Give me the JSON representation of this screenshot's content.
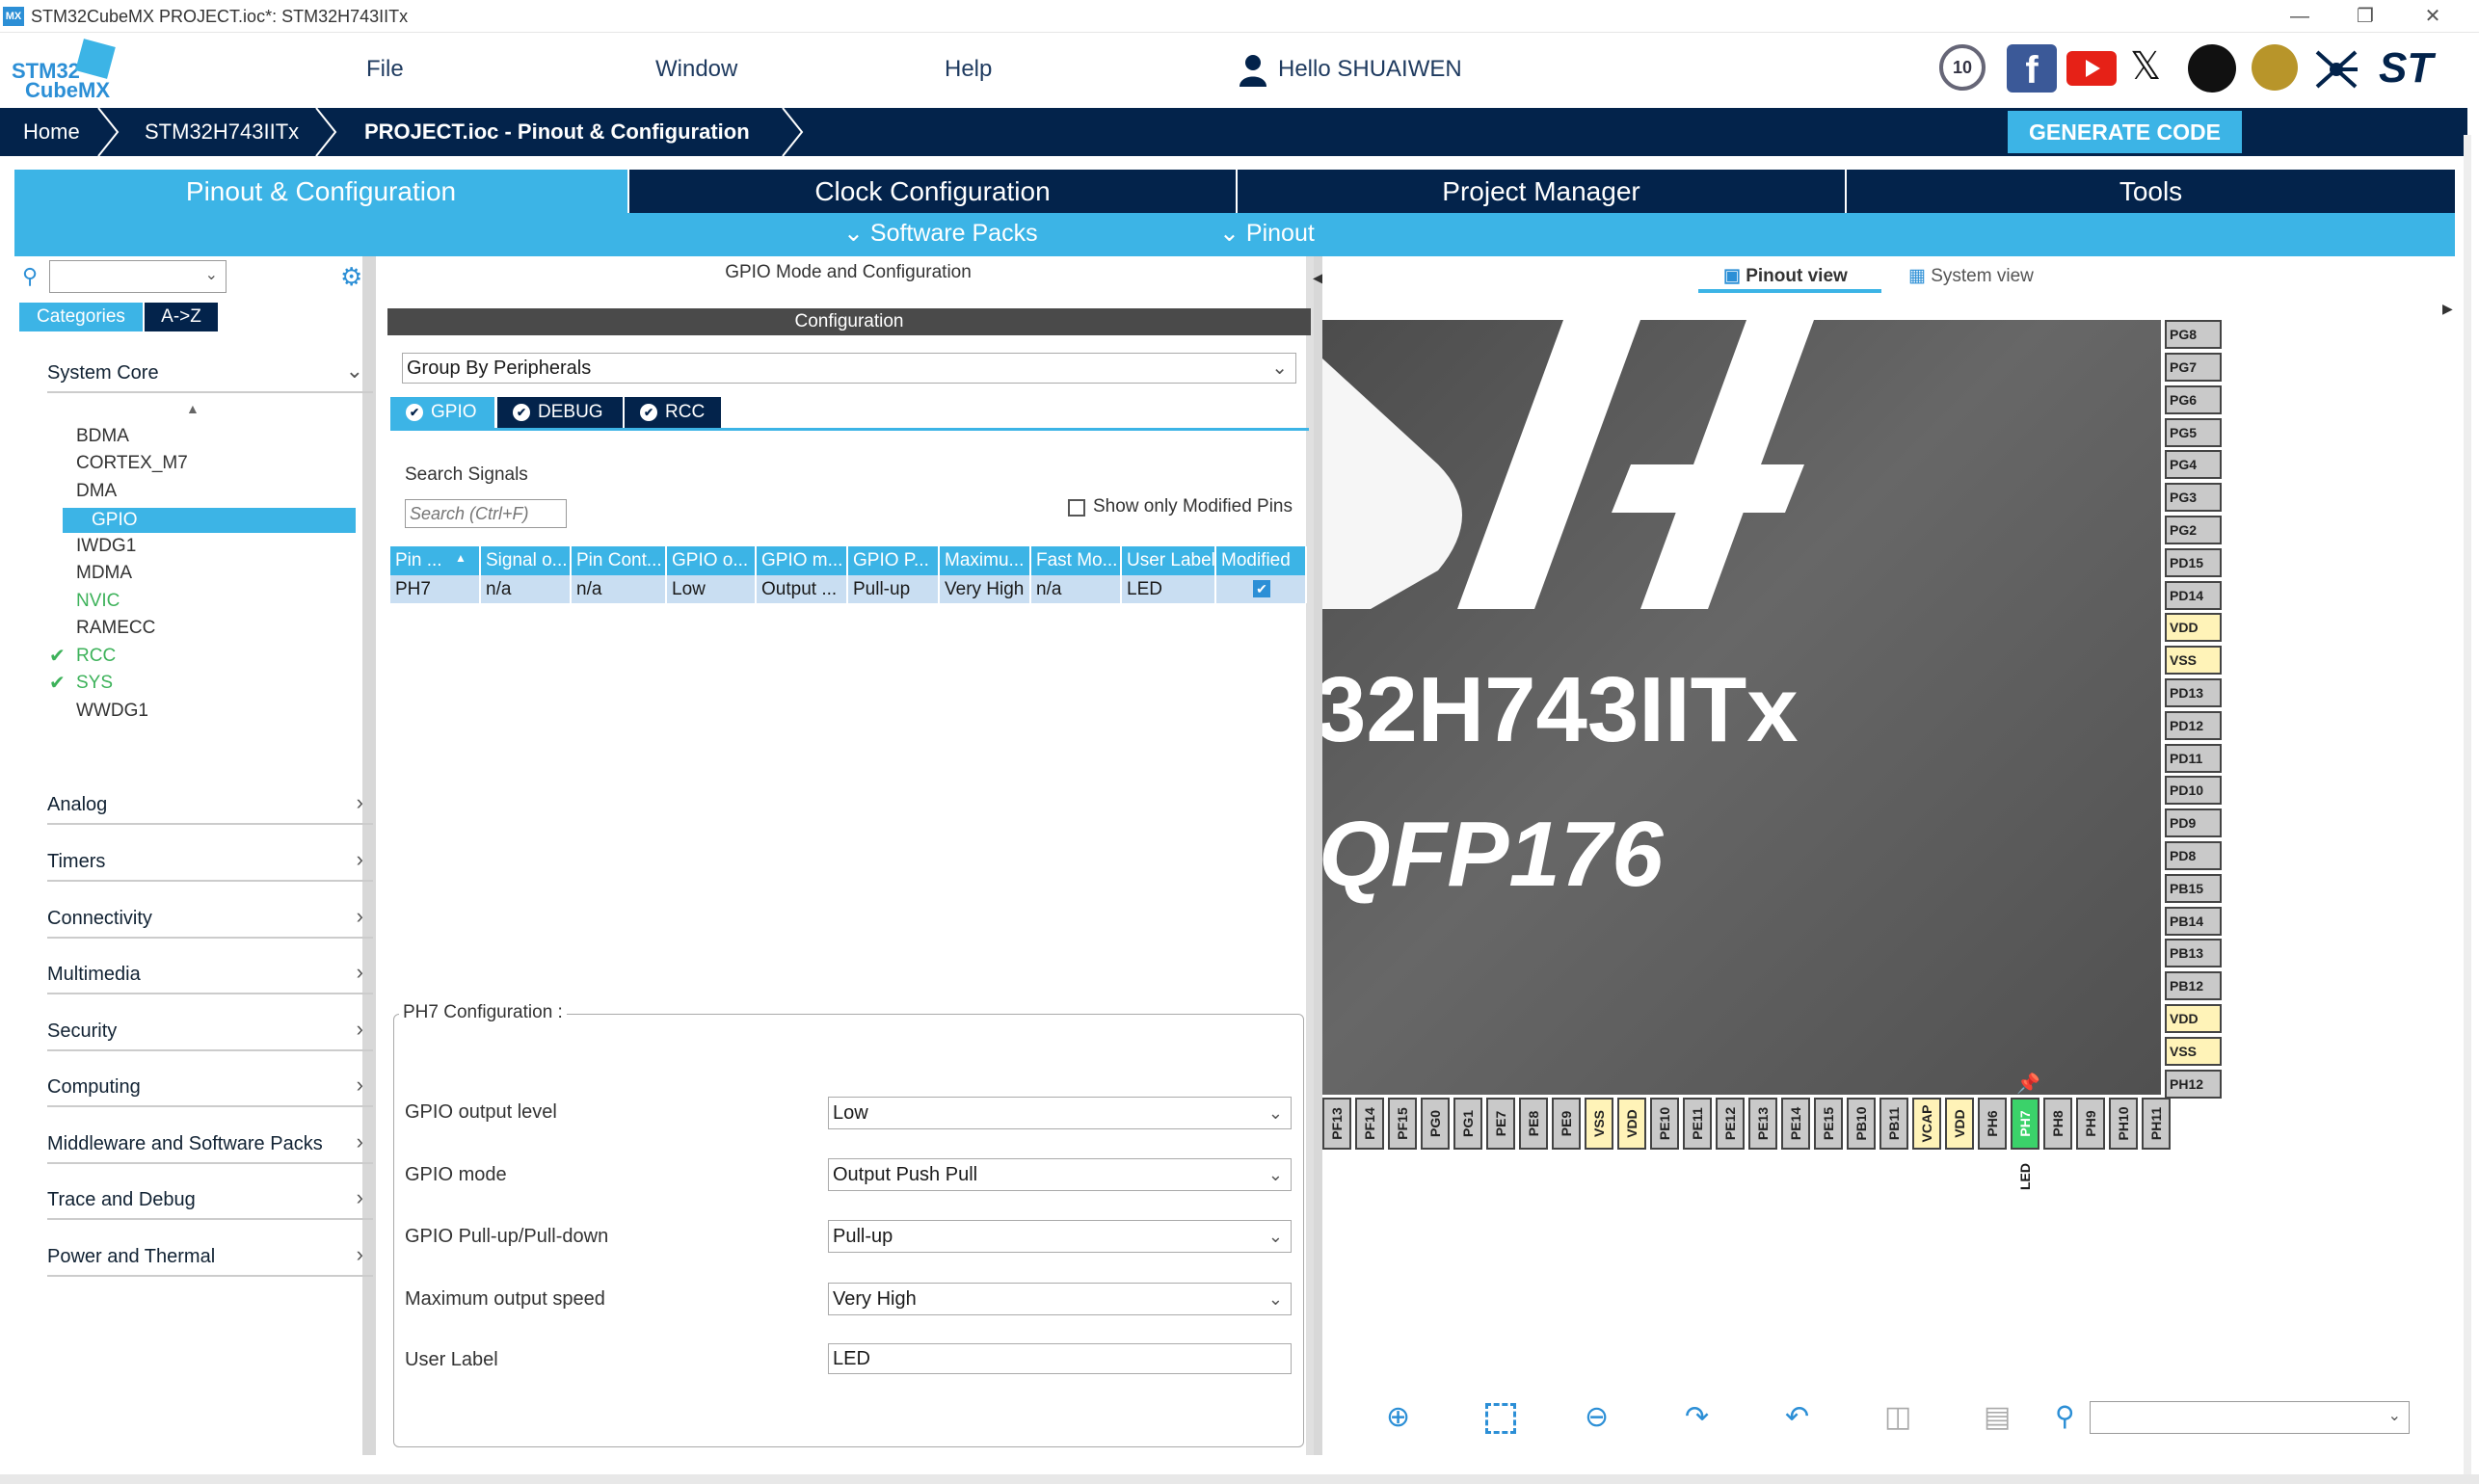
{
  "titlebar": {
    "app_icon": "MX",
    "title": "STM32CubeMX PROJECT.ioc*: STM32H743IITx"
  },
  "menu": {
    "logo_line1": "STM32",
    "logo_line2": "CubeMX",
    "file": "File",
    "window": "Window",
    "help": "Help",
    "user": "Hello SHUAIWEN",
    "badge": "10"
  },
  "breadcrumb": {
    "home": "Home",
    "mcu": "STM32H743IITx",
    "current": "PROJECT.ioc - Pinout & Configuration",
    "generate": "GENERATE CODE"
  },
  "tabs": {
    "pinout": "Pinout & Configuration",
    "clock": "Clock Configuration",
    "project": "Project Manager",
    "tools": "Tools",
    "software_packs": "Software Packs",
    "pinout_menu": "Pinout"
  },
  "left": {
    "categories": "Categories",
    "az": "A->Z",
    "system_core": "System Core",
    "core_items": [
      "BDMA",
      "CORTEX_M7",
      "DMA",
      "GPIO",
      "IWDG1",
      "MDMA",
      "NVIC",
      "RAMECC",
      "RCC",
      "SYS",
      "WWDG1"
    ],
    "sections": [
      "Analog",
      "Timers",
      "Connectivity",
      "Multimedia",
      "Security",
      "Computing",
      "Middleware and Software Packs",
      "Trace and Debug",
      "Power and Thermal"
    ]
  },
  "middle": {
    "header": "GPIO Mode and Configuration",
    "configuration": "Configuration",
    "group_by": "Group By Peripherals",
    "tabs": [
      "GPIO",
      "DEBUG",
      "RCC"
    ],
    "search_label": "Search Signals",
    "search_placeholder": "Search (Ctrl+F)",
    "show_modified": "Show only Modified Pins",
    "columns": [
      "Pin ...",
      "Signal o...",
      "Pin Cont...",
      "GPIO o...",
      "GPIO m...",
      "GPIO P...",
      "Maximu...",
      "Fast Mo...",
      "User Label",
      "Modified"
    ],
    "row": [
      "PH7",
      "n/a",
      "n/a",
      "Low",
      "Output ...",
      "Pull-up",
      "Very High",
      "n/a",
      "LED"
    ],
    "pin_config_title": "PH7 Configuration :",
    "fields": {
      "output_level_label": "GPIO output level",
      "output_level": "Low",
      "mode_label": "GPIO mode",
      "mode": "Output Push Pull",
      "pull_label": "GPIO Pull-up/Pull-down",
      "pull": "Pull-up",
      "speed_label": "Maximum output speed",
      "speed": "Very High",
      "user_label_label": "User Label",
      "user_label": "LED"
    }
  },
  "right": {
    "pinout_view": "Pinout view",
    "system_view": "System view",
    "chip_name": "32H743IITx",
    "package": "QFP176",
    "right_pins": [
      "PG8",
      "PG7",
      "PG6",
      "PG5",
      "PG4",
      "PG3",
      "PG2",
      "PD15",
      "PD14",
      "VDD",
      "VSS",
      "PD13",
      "PD12",
      "PD11",
      "PD10",
      "PD9",
      "PD8",
      "PB15",
      "PB14",
      "PB13",
      "PB12",
      "VDD",
      "VSS",
      "PH12"
    ],
    "bottom_pins": [
      "PF13",
      "PF14",
      "PF15",
      "PG0",
      "PG1",
      "PE7",
      "PE8",
      "PE9",
      "VSS",
      "VDD",
      "PE10",
      "PE11",
      "PE12",
      "PE13",
      "PE14",
      "PE15",
      "PB10",
      "PB11",
      "VCAP",
      "VDD",
      "PH6",
      "PH7",
      "PH8",
      "PH9",
      "PH10",
      "PH11"
    ],
    "pin_label_led": "LED"
  },
  "colors": {
    "navy": "#03234b",
    "accent": "#3cb4e6",
    "green": "#3db25a",
    "pin_active": "#3bd26a",
    "power_pin": "#fff3b8"
  },
  "icons": [
    "search-icon",
    "gear-icon",
    "zoom-in-icon",
    "fit-icon",
    "zoom-out-icon",
    "rotate-right-icon",
    "rotate-left-icon",
    "flip-icon",
    "split-icon"
  ]
}
